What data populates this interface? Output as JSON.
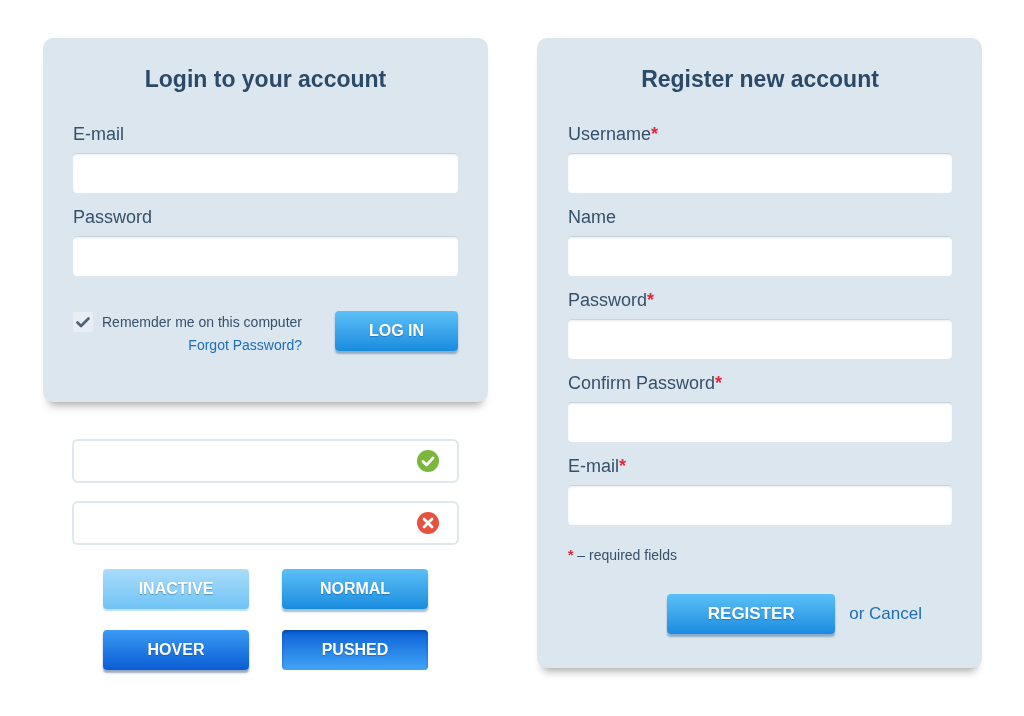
{
  "login": {
    "title": "Login to your account",
    "fields": [
      {
        "label": "E-mail"
      },
      {
        "label": "Password"
      }
    ],
    "remember": {
      "label": "Rememder me on this computer",
      "checked": true
    },
    "forgot_link": "Forgot Password?",
    "button": "LOG IN"
  },
  "validation_fields": [
    {
      "kind": "valid"
    },
    {
      "kind": "invalid"
    }
  ],
  "button_states": [
    {
      "label": "INACTIVE",
      "kind": "inactive"
    },
    {
      "label": "NORMAL",
      "kind": "normal"
    },
    {
      "label": "HOVER",
      "kind": "hover"
    },
    {
      "label": "PUSHED",
      "kind": "pushed"
    }
  ],
  "register": {
    "title": "Register new account",
    "fields": [
      {
        "label": "Username",
        "asterisk": "*"
      },
      {
        "label": "Name"
      },
      {
        "label": "Password",
        "asterisk": "*"
      },
      {
        "label": "Confirm Password",
        "asterisk": "*"
      },
      {
        "label": "E-mail",
        "asterisk": "*"
      }
    ],
    "required_note": {
      "mark": "*",
      "text": "– required fields"
    },
    "button": "REGISTER",
    "cancel_link": "or Cancel"
  }
}
